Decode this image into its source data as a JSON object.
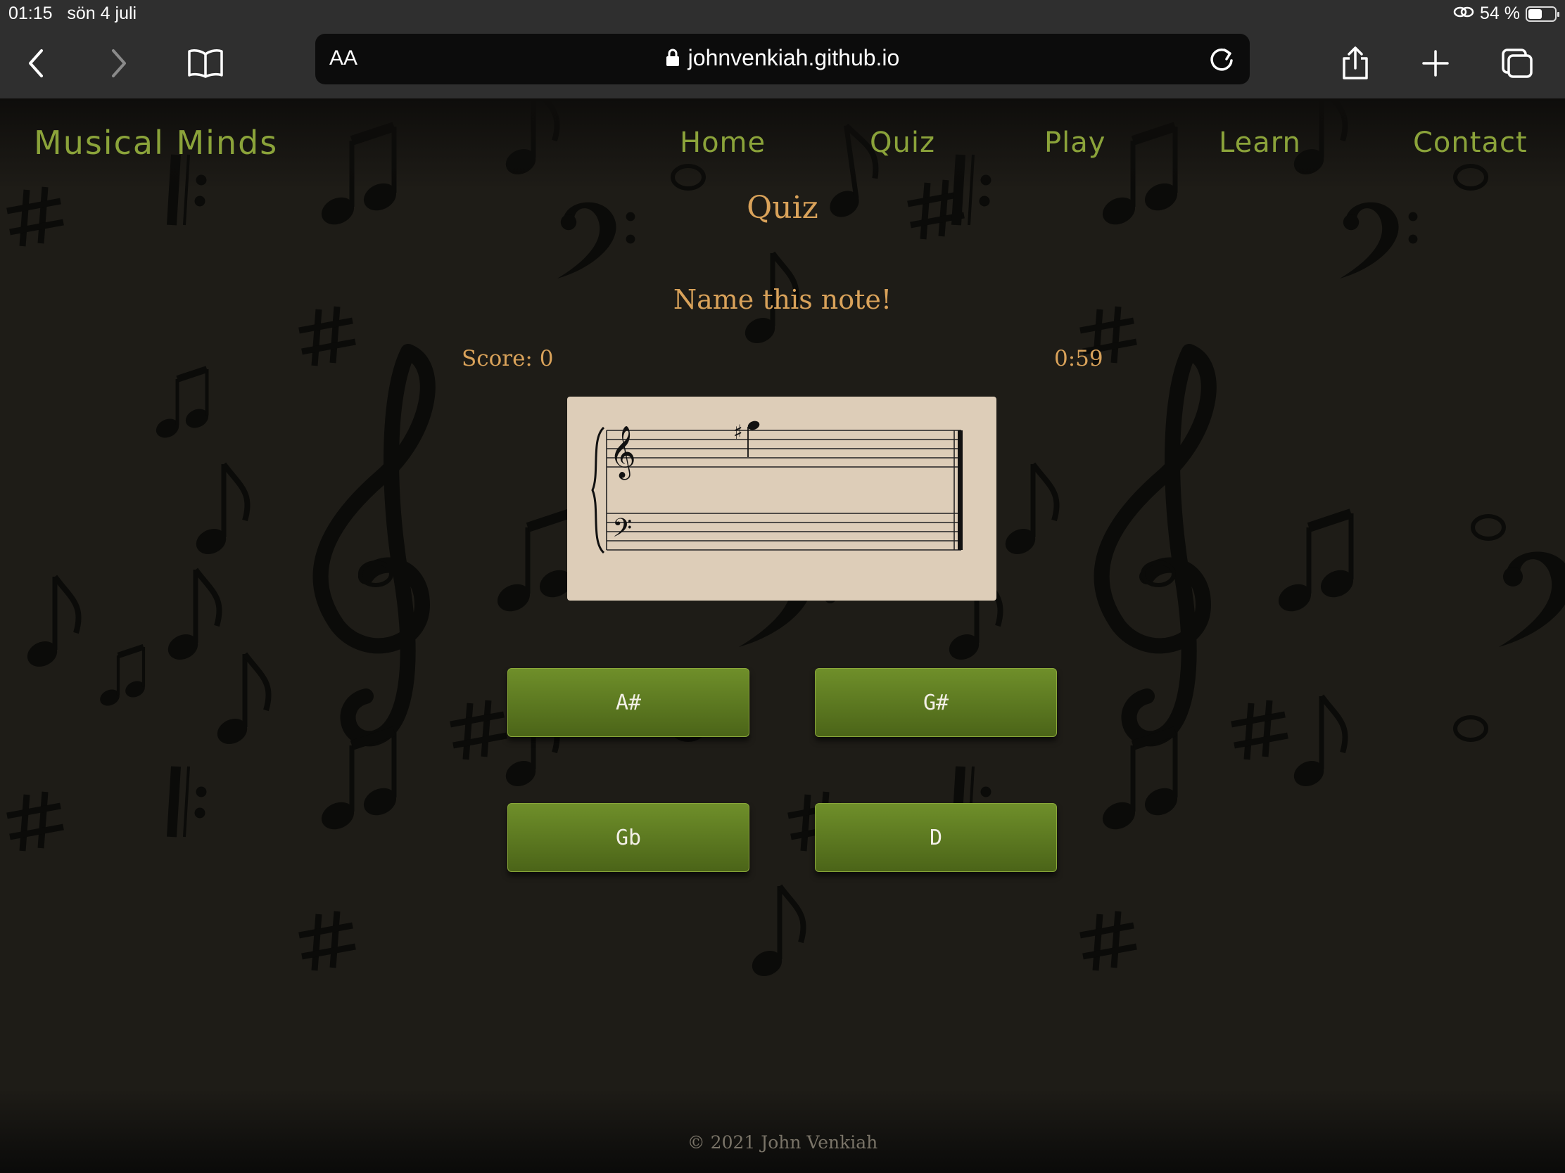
{
  "status_bar": {
    "time": "01:15",
    "date": "sön 4 juli",
    "battery": "54 %",
    "battery_level": 0.54
  },
  "browser": {
    "text_size_label": "AA",
    "url": "johnvenkiah.github.io"
  },
  "site": {
    "brand": "Musical Minds",
    "nav": [
      "Home",
      "Quiz",
      "Play",
      "Learn",
      "Contact"
    ]
  },
  "quiz": {
    "title": "Quiz",
    "prompt": "Name this note!",
    "score_label": "Score: 0",
    "timer": "0:59",
    "note": {
      "accidental": "♯",
      "clef": "treble"
    },
    "answers": [
      "A#",
      "G#",
      "Gb",
      "D"
    ]
  },
  "footer": {
    "copyright": "© 2021 John Venkiah"
  },
  "colors": {
    "accent_green": "#8ba33a",
    "heading_gold": "#d9a25a",
    "button_green": "#5d7a20",
    "page_bg": "#1e1c17",
    "staff_card": "#ddcdb8"
  }
}
